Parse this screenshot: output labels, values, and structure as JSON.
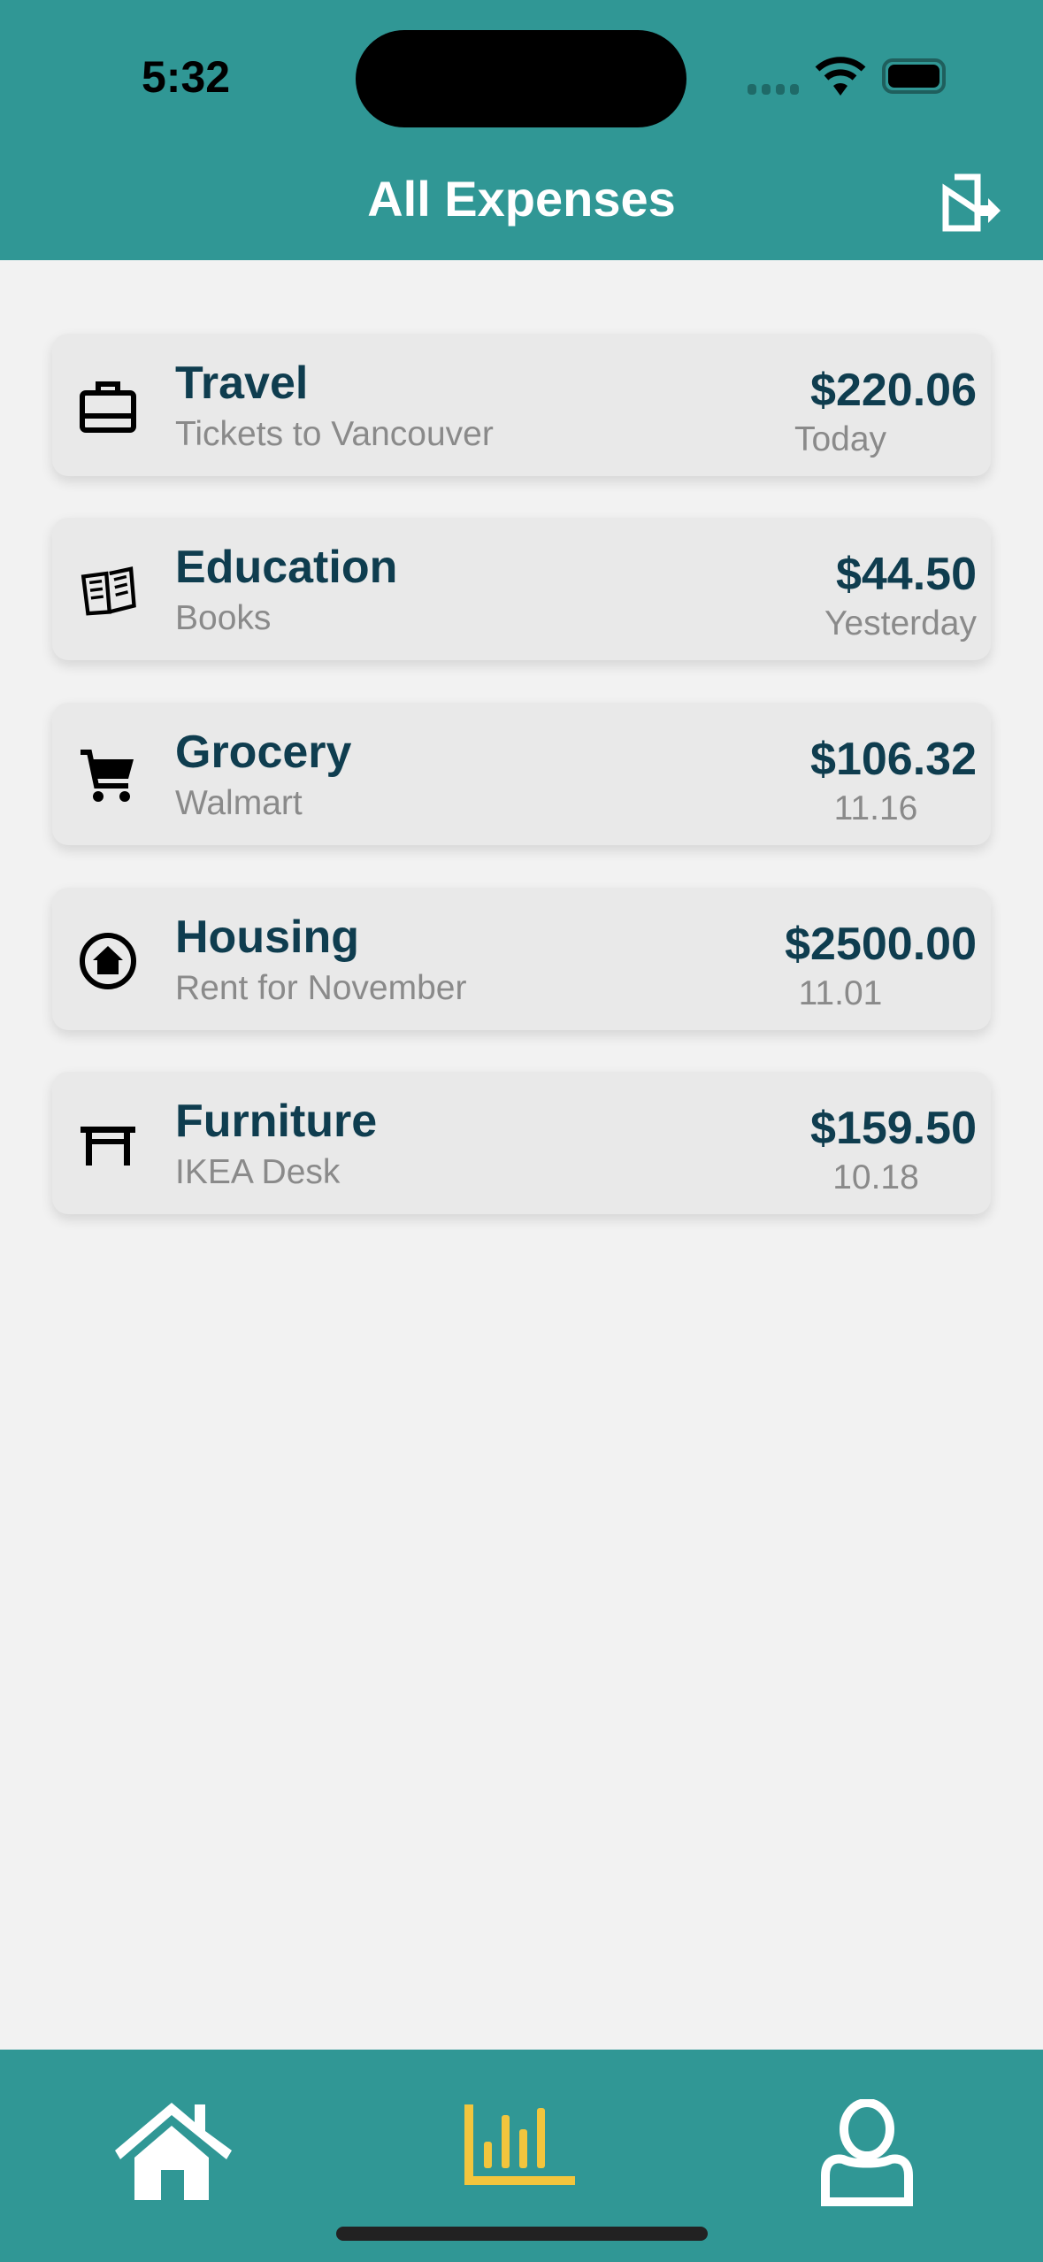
{
  "status_bar": {
    "time": "5:32"
  },
  "header": {
    "title": "All Expenses",
    "export_icon": "export-icon"
  },
  "expenses": [
    {
      "category": "Travel",
      "description": "Tickets to Vancouver",
      "amount": "$220.06",
      "date": "Today",
      "icon": "briefcase-icon"
    },
    {
      "category": "Education",
      "description": "Books",
      "amount": "$44.50",
      "date": "Yesterday",
      "icon": "book-icon"
    },
    {
      "category": "Grocery",
      "description": "Walmart",
      "amount": "$106.32",
      "date": "11.16",
      "icon": "cart-icon"
    },
    {
      "category": "Housing",
      "description": "Rent for November",
      "amount": "$2500.00",
      "date": "11.01",
      "icon": "home-circle-icon"
    },
    {
      "category": "Furniture",
      "description": "IKEA Desk",
      "amount": "$159.50",
      "date": "10.18",
      "icon": "table-icon"
    }
  ],
  "tabs": [
    {
      "name": "home",
      "icon": "home-icon",
      "active": false
    },
    {
      "name": "expenses",
      "icon": "bar-chart-icon",
      "active": true
    },
    {
      "name": "profile",
      "icon": "user-icon",
      "active": false
    }
  ],
  "colors": {
    "primary": "#309795",
    "accent": "#f2c53d",
    "text_dark": "#0f3d4f",
    "text_muted": "#8a8a8a"
  }
}
